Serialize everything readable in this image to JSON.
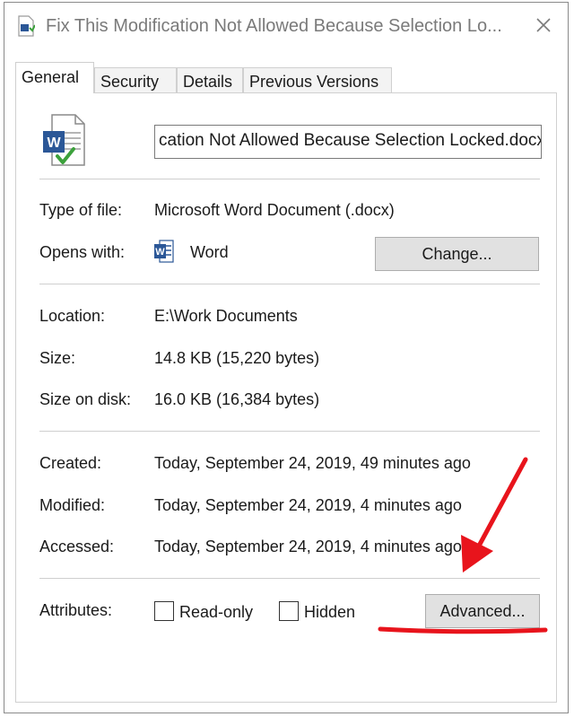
{
  "window": {
    "title": "Fix This Modification Not Allowed Because Selection Lo...",
    "close_icon": "close-icon"
  },
  "tabs": [
    {
      "label": "General",
      "active": true
    },
    {
      "label": "Security",
      "active": false
    },
    {
      "label": "Details",
      "active": false
    },
    {
      "label": "Previous Versions",
      "active": false
    }
  ],
  "general": {
    "filename_value": "cation Not Allowed Because Selection Locked.docx",
    "type_label": "Type of file:",
    "type_value": "Microsoft Word Document (.docx)",
    "opens_label": "Opens with:",
    "opens_value": "Word",
    "change_button": "Change...",
    "location_label": "Location:",
    "location_value": "E:\\Work Documents",
    "size_label": "Size:",
    "size_value": "14.8 KB (15,220 bytes)",
    "size_disk_label": "Size on disk:",
    "size_disk_value": "16.0 KB (16,384 bytes)",
    "created_label": "Created:",
    "created_value": "Today, September 24, 2019, 49 minutes ago",
    "modified_label": "Modified:",
    "modified_value": "Today, September 24, 2019, 4 minutes ago",
    "accessed_label": "Accessed:",
    "accessed_value": "Today, September 24, 2019, 4 minutes ago",
    "attributes_label": "Attributes:",
    "readonly_label": "Read-only",
    "readonly_checked": false,
    "hidden_label": "Hidden",
    "hidden_checked": false,
    "advanced_button": "Advanced..."
  },
  "annotation": {
    "color": "#e8141c"
  }
}
